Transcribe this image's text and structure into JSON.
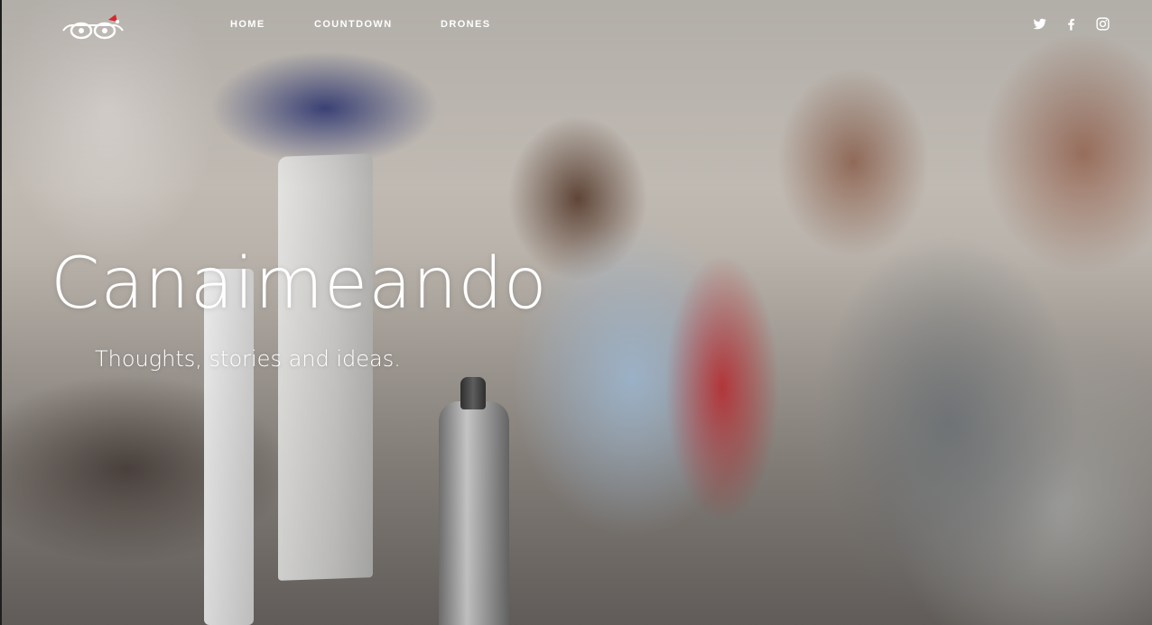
{
  "site": {
    "logo_icon": "glasses-santa-hat-logo"
  },
  "nav": {
    "items": [
      {
        "label": "HOME"
      },
      {
        "label": "COUNTDOWN"
      },
      {
        "label": "DRONES"
      }
    ]
  },
  "social": {
    "items": [
      {
        "icon": "twitter-icon"
      },
      {
        "icon": "facebook-icon"
      },
      {
        "icon": "instagram-icon"
      }
    ]
  },
  "hero": {
    "title": "Canaimeando",
    "subtitle": "Thoughts, stories and ideas."
  },
  "colors": {
    "text": "#ffffff",
    "accent": "#d9262b"
  }
}
